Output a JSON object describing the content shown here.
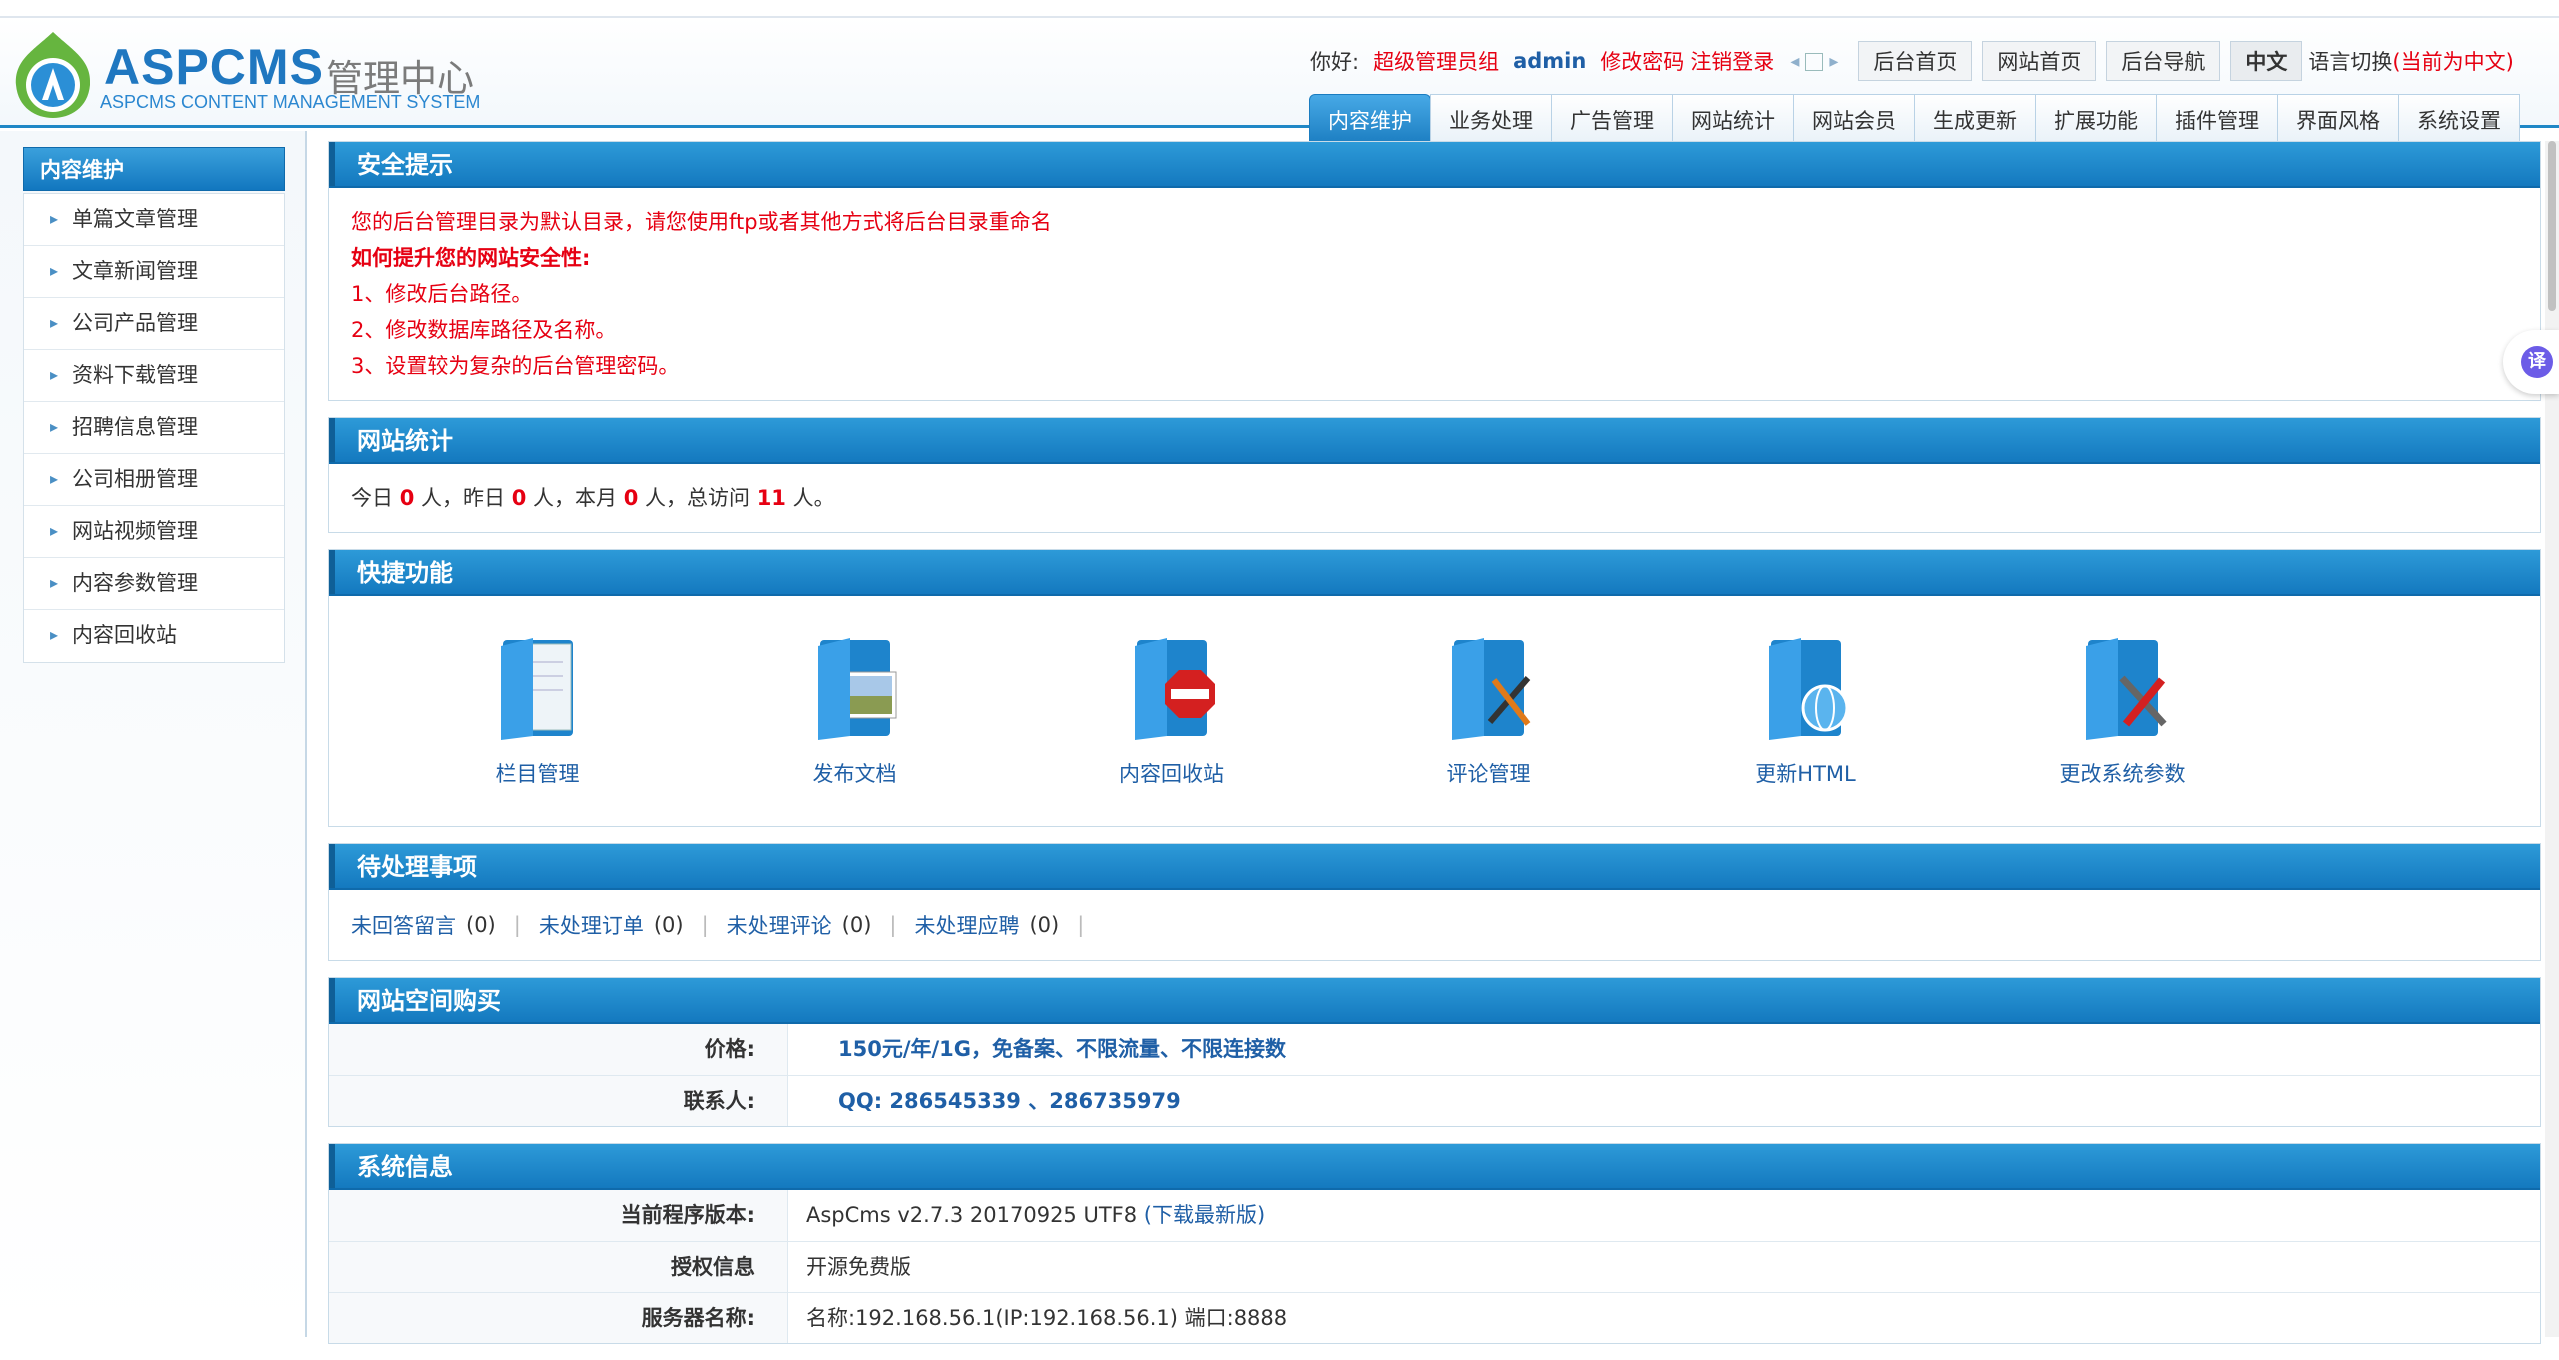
{
  "brand": {
    "title": "ASPCMS",
    "cn": "管理中心",
    "sub": "ASPCMS CONTENT MANAGEMENT SYSTEM"
  },
  "userbar": {
    "greeting": "你好:",
    "role": "超级管理员组",
    "user": "admin",
    "change_pwd": "修改密码",
    "logout": "注销登录",
    "buttons": [
      "后台首页",
      "网站首页",
      "后台导航"
    ],
    "lang": "中文",
    "lang_switch": "语言切换",
    "lang_current": "(当前为中文)"
  },
  "tabs": [
    "内容维护",
    "业务处理",
    "广告管理",
    "网站统计",
    "网站会员",
    "生成更新",
    "扩展功能",
    "插件管理",
    "界面风格",
    "系统设置"
  ],
  "sidebar": {
    "title": "内容维护",
    "items": [
      "单篇文章管理",
      "文章新闻管理",
      "公司产品管理",
      "资料下载管理",
      "招聘信息管理",
      "公司相册管理",
      "网站视频管理",
      "内容参数管理",
      "内容回收站"
    ]
  },
  "security": {
    "title": "安全提示",
    "warning": "您的后台管理目录为默认目录，请您使用ftp或者其他方式将后台目录重命名",
    "how": "如何提升您的网站安全性:",
    "tips": [
      "1、修改后台路径。",
      "2、修改数据库路径及名称。",
      "3、设置较为复杂的后台管理密码。"
    ]
  },
  "stats": {
    "title": "网站统计",
    "today_label": "今日",
    "today": "0",
    "yesterday_label": "人，昨日",
    "yesterday": "0",
    "month_label": "人，本月",
    "month": "0",
    "total_label": "人，总访问",
    "total": "11",
    "end": "人。"
  },
  "quick": {
    "title": "快捷功能",
    "items": [
      {
        "label": "栏目管理",
        "icon": "folder-doc-icon"
      },
      {
        "label": "发布文档",
        "icon": "folder-image-icon"
      },
      {
        "label": "内容回收站",
        "icon": "folder-delete-icon"
      },
      {
        "label": "评论管理",
        "icon": "folder-pen-icon"
      },
      {
        "label": "更新HTML",
        "icon": "folder-globe-icon"
      },
      {
        "label": "更改系统参数",
        "icon": "folder-tools-icon"
      }
    ]
  },
  "todo": {
    "title": "待处理事项",
    "items": [
      {
        "label": "未回答留言",
        "count": "(0)"
      },
      {
        "label": "未处理订单",
        "count": "(0)"
      },
      {
        "label": "未处理评论",
        "count": "(0)"
      },
      {
        "label": "未处理应聘",
        "count": "(0)"
      }
    ]
  },
  "hosting": {
    "title": "网站空间购买",
    "price_label": "价格:",
    "price": "150元/年/1G，免备案、不限流量、不限连接数",
    "contact_label": "联系人:",
    "contact": "QQ: 286545339 、286735979"
  },
  "sysinfo": {
    "title": "系统信息",
    "version_label": "当前程序版本:",
    "version": "AspCms v2.7.3 20170925 UTF8",
    "download": "(下载最新版)",
    "license_label": "授权信息",
    "license": "开源免费版",
    "server_label": "服务器名称:",
    "server": "名称:192.168.56.1(IP:192.168.56.1) 端口:8888"
  },
  "translate": {
    "label": "译"
  },
  "colors": {
    "accent": "#1479bf",
    "alert": "#e60012",
    "link": "#1f5fa6"
  }
}
